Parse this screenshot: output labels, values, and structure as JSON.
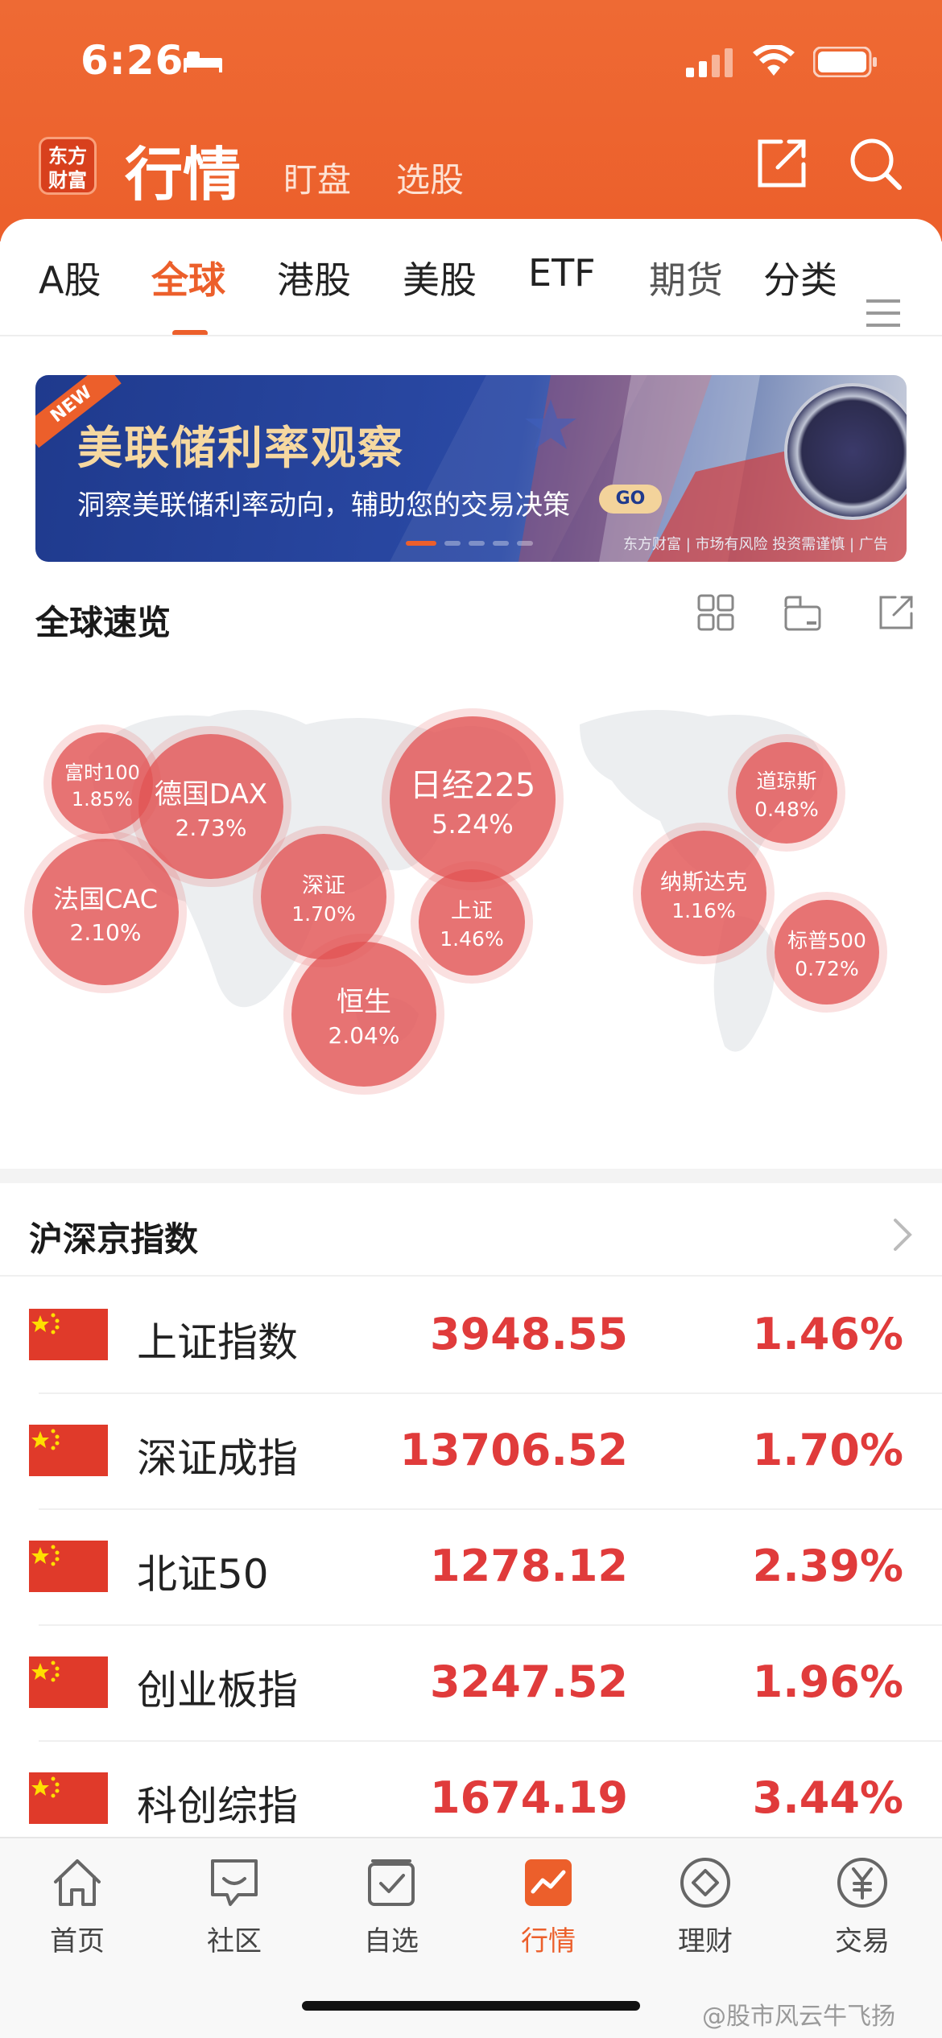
{
  "status_bar": {
    "time": "6:26"
  },
  "header": {
    "logo_text": "东方财富",
    "title": "行情",
    "sub_tabs": [
      "盯盘",
      "选股"
    ]
  },
  "market_tabs": {
    "items": [
      "A股",
      "全球",
      "港股",
      "美股",
      "ETF",
      "期货",
      "分类"
    ],
    "active": "全球"
  },
  "banner": {
    "badge": "NEW",
    "title": "美联储利率观察",
    "subtitle": "洞察美联储利率动向，辅助您的交易决策",
    "cta": "GO",
    "footer": "东方财富 | 市场有风险 投资需谨慎 | 广告"
  },
  "global_overview": {
    "title": "全球速览",
    "bubbles": [
      {
        "name": "富时100",
        "value": "1.85%"
      },
      {
        "name": "德国DAX",
        "value": "2.73%"
      },
      {
        "name": "日经225",
        "value": "5.24%"
      },
      {
        "name": "道琼斯",
        "value": "0.48%"
      },
      {
        "name": "法国CAC",
        "value": "2.10%"
      },
      {
        "name": "深证",
        "value": "1.70%"
      },
      {
        "name": "上证",
        "value": "1.46%"
      },
      {
        "name": "纳斯达克",
        "value": "1.16%"
      },
      {
        "name": "标普500",
        "value": "0.72%"
      },
      {
        "name": "恒生",
        "value": "2.04%"
      }
    ]
  },
  "index_list": {
    "title": "沪深京指数",
    "rows": [
      {
        "name": "上证指数",
        "price": "3948.55",
        "change": "1.46%"
      },
      {
        "name": "深证成指",
        "price": "13706.52",
        "change": "1.70%"
      },
      {
        "name": "北证50",
        "price": "1278.12",
        "change": "2.39%"
      },
      {
        "name": "创业板指",
        "price": "3247.52",
        "change": "1.96%"
      },
      {
        "name": "科创综指",
        "price": "1674.19",
        "change": "3.44%"
      }
    ]
  },
  "bottom_nav": {
    "items": [
      "首页",
      "社区",
      "自选",
      "行情",
      "理财",
      "交易"
    ],
    "active": "行情"
  },
  "watermark": "@股市风云牛飞扬",
  "colors": {
    "brand": "#ec5f2b",
    "rise": "#e03b3b"
  }
}
